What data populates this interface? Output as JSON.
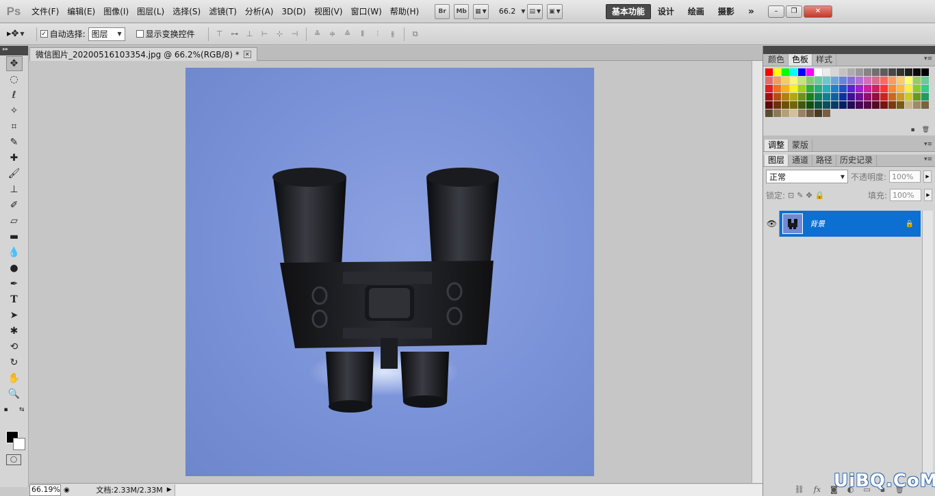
{
  "app": {
    "logo": "Ps"
  },
  "menu": [
    "文件(F)",
    "编辑(E)",
    "图像(I)",
    "图层(L)",
    "选择(S)",
    "滤镜(T)",
    "分析(A)",
    "3D(D)",
    "视图(V)",
    "窗口(W)",
    "帮助(H)"
  ],
  "toolbar": {
    "bridge": "Br",
    "minibridge": "Mb",
    "zoom": "66.2"
  },
  "workspaces": [
    "基本功能",
    "设计",
    "绘画",
    "摄影"
  ],
  "options": {
    "auto_select": "自动选择:",
    "auto_select_target": "图层",
    "show_transform": "显示变换控件"
  },
  "document": {
    "tab_title": "微信图片_20200516103354.jpg @ 66.2%(RGB/8) *",
    "zoom_field": "66.19%",
    "doc_info": "文档:2.33M/2.33M"
  },
  "panels": {
    "top_tabs": [
      "颜色",
      "色板",
      "样式"
    ],
    "adjust_tabs": [
      "调整",
      "蒙版"
    ],
    "layers_tabs": [
      "图层",
      "通道",
      "路径",
      "历史记录"
    ],
    "blend_mode": "正常",
    "opacity_label": "不透明度:",
    "opacity_value": "100%",
    "lock_label": "锁定:",
    "fill_label": "填充:",
    "fill_value": "100%",
    "layer_name": "背景"
  },
  "swatches": [
    "#ff0000",
    "#ffff00",
    "#00ff00",
    "#00ffff",
    "#0000ff",
    "#ff00ff",
    "#ffffff",
    "#ebebeb",
    "#d6d6d6",
    "#c2c2c2",
    "#adadad",
    "#999999",
    "#858585",
    "#707070",
    "#5c5c5c",
    "#474747",
    "#333333",
    "#1f1f1f",
    "#0a0a0a",
    "#000000",
    "#e36c6c",
    "#f29c64",
    "#f7c96b",
    "#fff47c",
    "#c3e37c",
    "#82cc70",
    "#6ccc9c",
    "#6cc7cc",
    "#6ca3d8",
    "#6c82d8",
    "#8a6cd8",
    "#b56cd8",
    "#d86cb8",
    "#d86c8c",
    "#ff6666",
    "#ff9966",
    "#ffcc66",
    "#ffff66",
    "#99cc66",
    "#66cc99",
    "#e02020",
    "#f07020",
    "#f7b020",
    "#fff020",
    "#a0d020",
    "#30b030",
    "#20b080",
    "#20b0c0",
    "#2080d0",
    "#2050d0",
    "#6020d0",
    "#a020d0",
    "#d020a0",
    "#d02060",
    "#ff3333",
    "#ff8833",
    "#ffbb33",
    "#ffee33",
    "#88cc33",
    "#33cc88",
    "#a01010",
    "#b05010",
    "#b08010",
    "#b0a810",
    "#70901a",
    "#1a801a",
    "#108060",
    "#108090",
    "#1060a0",
    "#1030a0",
    "#401090",
    "#701090",
    "#901070",
    "#901040",
    "#cc2222",
    "#cc6622",
    "#cc9922",
    "#cccc22",
    "#669922",
    "#229966",
    "#600808",
    "#703008",
    "#705008",
    "#706808",
    "#405810",
    "#105010",
    "#085040",
    "#085060",
    "#083c68",
    "#081c68",
    "#280858",
    "#480858",
    "#580848",
    "#580828",
    "#7a1414",
    "#7a3a14",
    "#7a5a14",
    "#c8b48c",
    "#a08c64",
    "#786440",
    "#5a4a30",
    "#8a7a5a",
    "#b4a078",
    "#d2bea0",
    "#9a8262",
    "#6e5a3e",
    "#4a3a24",
    "#7a6040"
  ],
  "watermark": "UiBQ.CoM"
}
